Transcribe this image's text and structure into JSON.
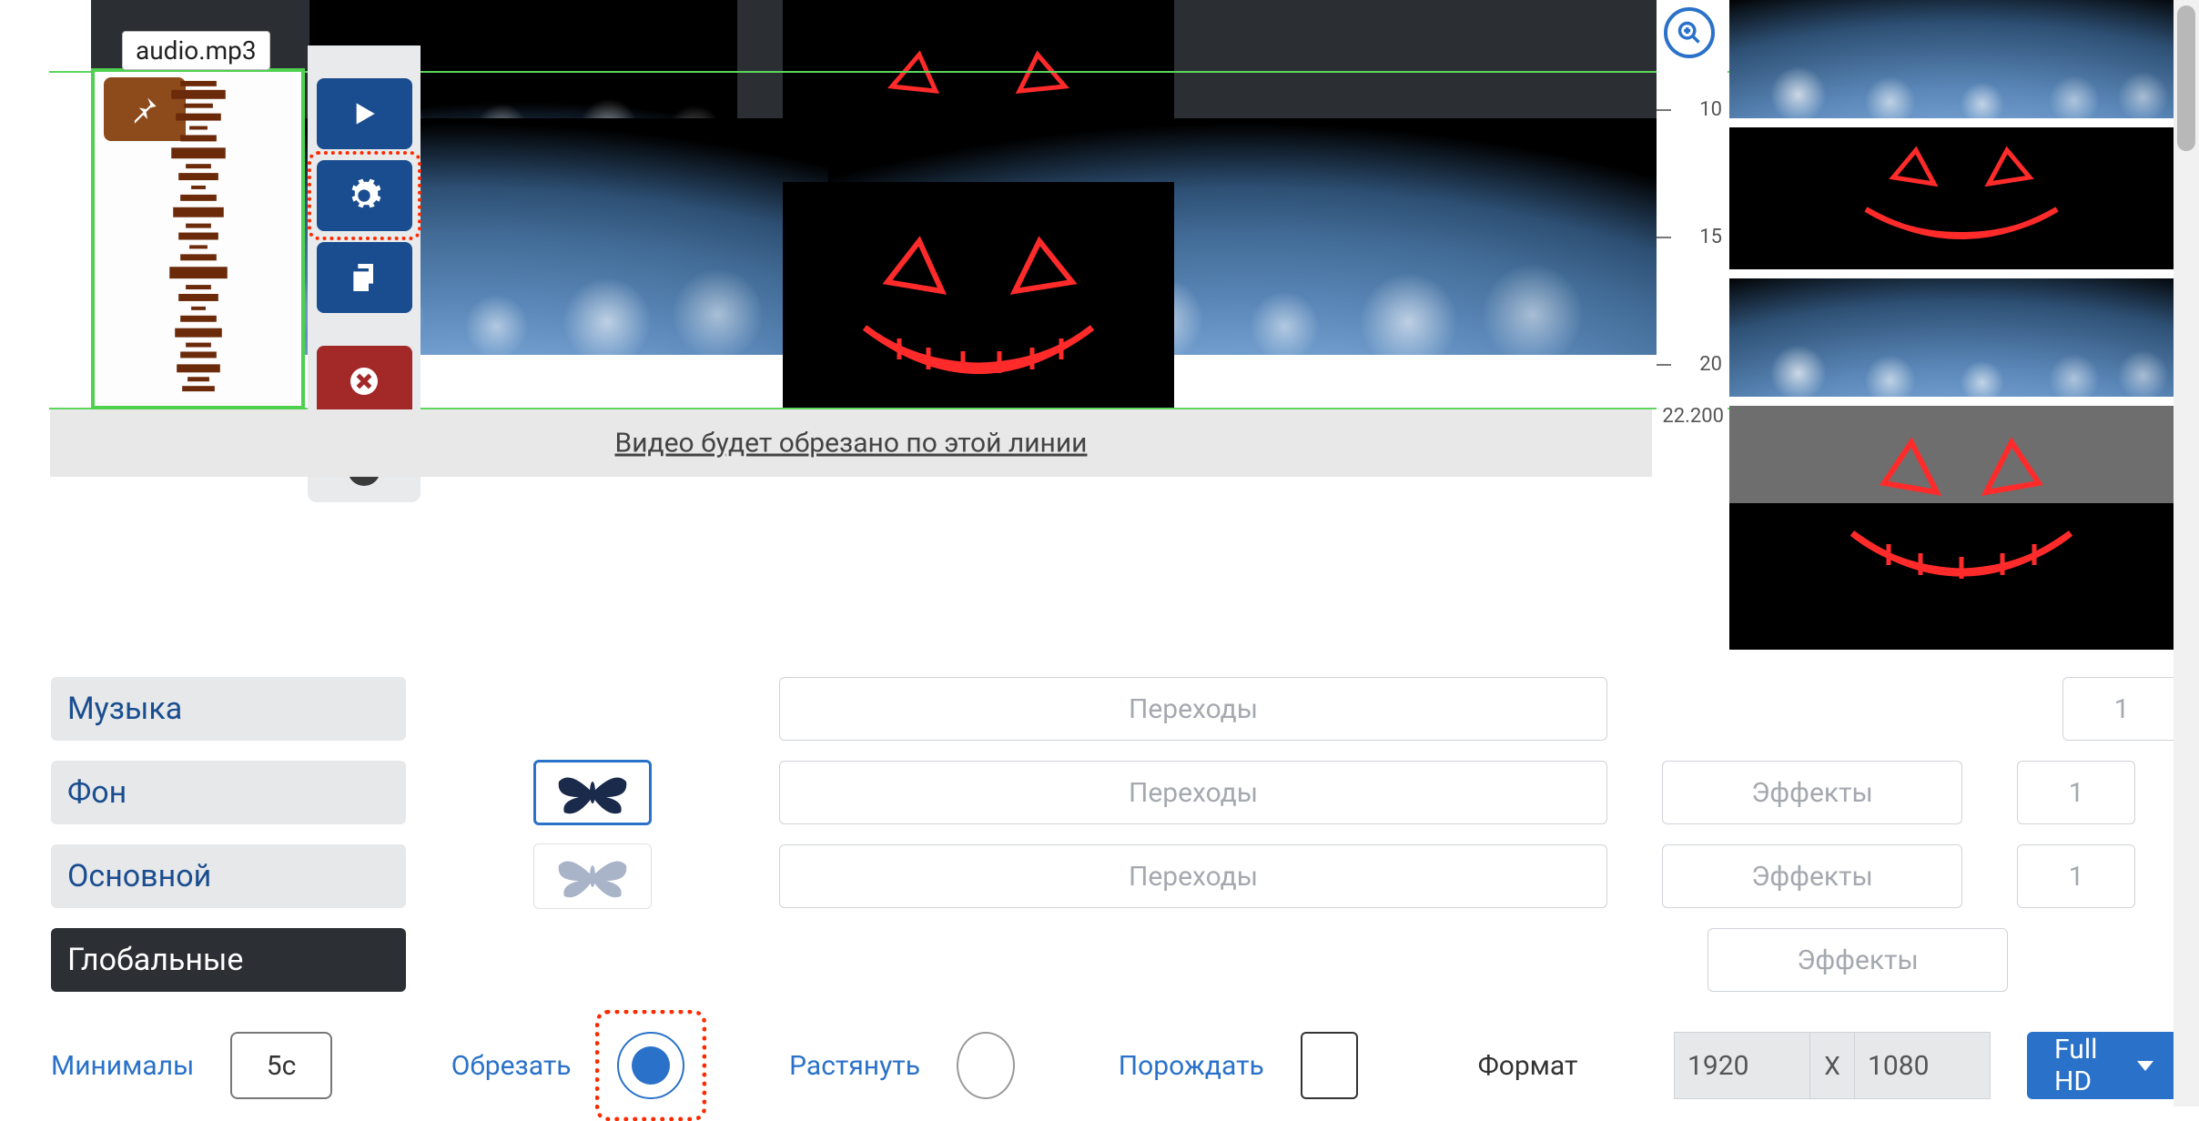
{
  "clip": {
    "filename": "audio.mp3"
  },
  "trim": {
    "message": "Видео будет обрезано по этой линии"
  },
  "ruler": {
    "ticks": [
      "10",
      "15",
      "20"
    ],
    "end": "22.200"
  },
  "settings": {
    "rows": [
      {
        "label": "Музыка",
        "transitions": "Переходы",
        "effects": null,
        "count": "1"
      },
      {
        "label": "Фон",
        "transitions": "Переходы",
        "effects": "Эффекты",
        "count": "1"
      },
      {
        "label": "Основной",
        "transitions": "Переходы",
        "effects": "Эффекты",
        "count": "1"
      },
      {
        "label": "Глобальные",
        "transitions": null,
        "effects": "Эффекты",
        "count": null
      }
    ]
  },
  "bottom": {
    "min_label": "Минималы",
    "min_value": "5с",
    "trim_label": "Обрезать",
    "stretch_label": "Растянуть",
    "spawn_label": "Порождать",
    "format_label": "Формат",
    "width": "1920",
    "x": "X",
    "height": "1080",
    "preset": "Full HD"
  },
  "icons": {
    "zoom": "zoom-in-icon",
    "pin": "pin-icon",
    "play": "play-icon",
    "settings": "gear-icon",
    "copy": "copy-icon",
    "delete": "close-circle-icon",
    "help": "?"
  }
}
